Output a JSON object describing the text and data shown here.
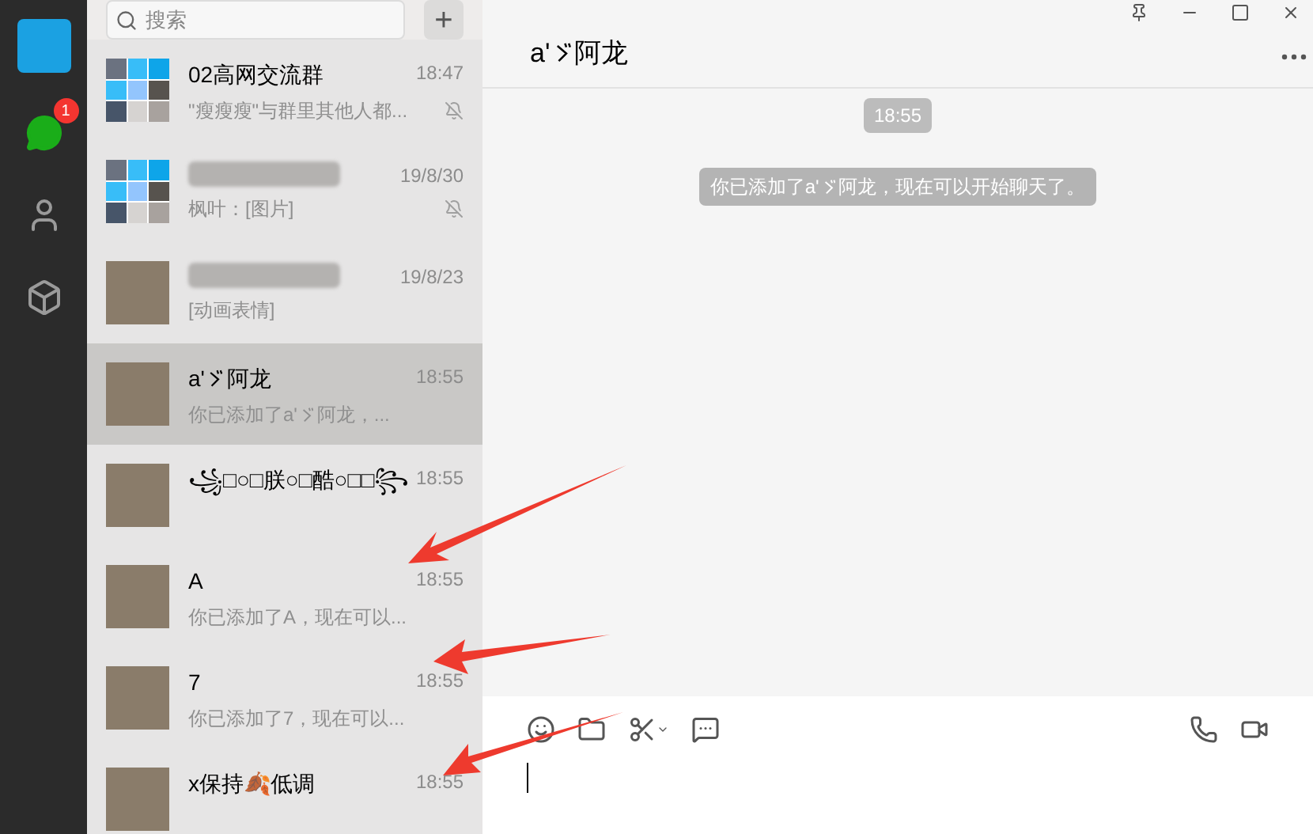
{
  "sidebar": {
    "unread_badge": "1",
    "items": [
      {
        "kind": "chat",
        "selected": true
      },
      {
        "kind": "contacts",
        "selected": false
      },
      {
        "kind": "box",
        "selected": false
      }
    ]
  },
  "search": {
    "placeholder": "搜索",
    "add_button": "+"
  },
  "chats": [
    {
      "kind": "group",
      "name": "02高网交流群",
      "name_blurred": false,
      "time": "18:47",
      "preview": "\"瘦瘦瘦\"与群里其他人都...",
      "muted": true,
      "selected": false
    },
    {
      "kind": "group",
      "name_blurred": true,
      "time": "19/8/30",
      "preview": "枫叶：[图片]",
      "muted": true,
      "selected": false
    },
    {
      "kind": "contact",
      "name_blurred": true,
      "time": "19/8/23",
      "preview": "[动画表情]",
      "muted": false,
      "selected": false
    },
    {
      "kind": "contact",
      "name": "a'",
      "name_after_mark": "阿龙",
      "name_blurred": false,
      "time": "18:55",
      "preview": "你已添加了a'",
      "preview_after_mark": "阿龙，...",
      "muted": false,
      "selected": true
    },
    {
      "kind": "contact",
      "name": "꧁□○□朕○□酷○□□꧂",
      "name_blurred": false,
      "time": "18:55",
      "muted": false,
      "selected": false
    },
    {
      "kind": "contact",
      "name": "A",
      "name_blurred": false,
      "time": "18:55",
      "preview": "你已添加了A，现在可以...",
      "muted": false,
      "selected": false
    },
    {
      "kind": "contact",
      "name": "7",
      "name_blurred": false,
      "time": "18:55",
      "preview": "你已添加了7，现在可以...",
      "muted": false,
      "selected": false
    },
    {
      "kind": "contact",
      "name": "x保持🍂低调",
      "name_blurred": false,
      "time": "18:55",
      "muted": false,
      "selected": false
    }
  ],
  "chat": {
    "title": "a'",
    "title_after_mark": "阿龙",
    "messages": [
      {
        "kind": "time",
        "text": "18:55"
      },
      {
        "kind": "system",
        "text": "你已添加了a'",
        "text_after_mark": "阿龙，现在可以开始聊天了。"
      }
    ]
  }
}
